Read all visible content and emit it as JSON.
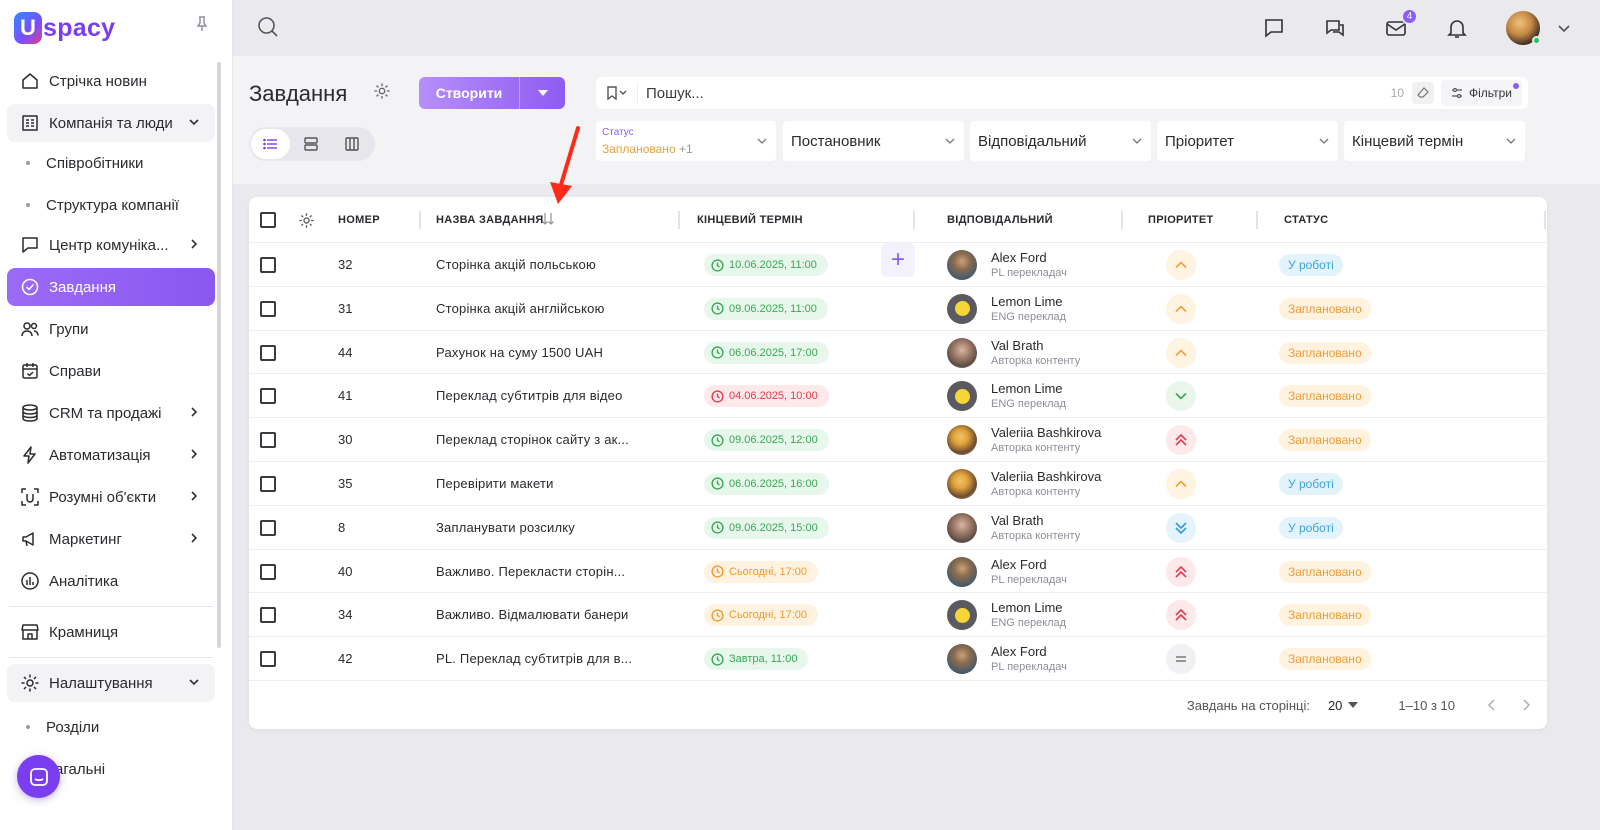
{
  "app": {
    "logo_letter": "U",
    "logo_text": "spacy"
  },
  "sidebar": {
    "items": [
      {
        "label": "Стрічка новин",
        "icon": "home-icon"
      },
      {
        "label": "Компанія та люди",
        "icon": "building-icon",
        "expanded": true
      },
      {
        "label": "Співробітники",
        "sub": true
      },
      {
        "label": "Структура компанії",
        "sub": true
      },
      {
        "label": "Центр комуніка...",
        "icon": "chat-icon"
      },
      {
        "label": "Завдання",
        "icon": "check-circle-icon",
        "active": true
      },
      {
        "label": "Групи",
        "icon": "users-icon"
      },
      {
        "label": "Справи",
        "icon": "calendar-icon"
      },
      {
        "label": "CRM та продажі",
        "icon": "database-icon"
      },
      {
        "label": "Автоматизація",
        "icon": "bolt-icon"
      },
      {
        "label": "Розумні об'єкти",
        "icon": "scan-icon"
      },
      {
        "label": "Маркетинг",
        "icon": "megaphone-icon"
      },
      {
        "label": "Аналітика",
        "icon": "chart-icon"
      },
      {
        "label": "Крамниця",
        "icon": "store-icon"
      },
      {
        "label": "Налаштування",
        "icon": "gear-icon",
        "expanded": true
      },
      {
        "label": "Розділи",
        "sub": true
      },
      {
        "label": "Загальні",
        "sub": true
      }
    ]
  },
  "topbar": {
    "mail_badge": "4"
  },
  "header": {
    "title": "Завдання",
    "create_label": "Створити",
    "search_placeholder": "Пошук...",
    "search_count": "10",
    "filters_label": "Фільтри",
    "filters": {
      "status_label": "Статус",
      "status_value": "Заплановано",
      "status_more": "+1",
      "author": "Постановник",
      "assignee": "Відповідальний",
      "priority": "Пріоритет",
      "deadline": "Кінцевий термін"
    }
  },
  "table": {
    "columns": {
      "number": "НОМЕР",
      "name": "НАЗВА ЗАВДАННЯ",
      "deadline": "КІНЦЕВИЙ ТЕРМІН",
      "assignee": "ВІДПОВІДАЛЬНИЙ",
      "priority": "ПРІОРИТЕТ",
      "status": "СТАТУС"
    },
    "rows": [
      {
        "num": "32",
        "name": "Сторінка акцій польською",
        "deadline": "10.06.2025, 11:00",
        "dl": "ok",
        "person": "Alex Ford",
        "role": "PL перекладач",
        "av": "alex",
        "priority": "medium",
        "status": "У роботі",
        "st": "work"
      },
      {
        "num": "31",
        "name": "Сторінка акцій англійською",
        "deadline": "09.06.2025, 11:00",
        "dl": "ok",
        "person": "Lemon Lime",
        "role": "ENG переклад",
        "av": "lemon",
        "priority": "medium",
        "status": "Заплановано",
        "st": "plan"
      },
      {
        "num": "44",
        "name": "Рахунок на суму 1500 UAH",
        "deadline": "06.06.2025, 17:00",
        "dl": "ok",
        "person": "Val Brath",
        "role": "Авторка контенту",
        "av": "val",
        "priority": "medium",
        "status": "Заплановано",
        "st": "plan"
      },
      {
        "num": "41",
        "name": "Переклад субтитрів для відео",
        "deadline": "04.06.2025, 10:00",
        "dl": "late",
        "person": "Lemon Lime",
        "role": "ENG переклад",
        "av": "lemon",
        "priority": "low",
        "status": "Заплановано",
        "st": "plan"
      },
      {
        "num": "30",
        "name": "Переклад сторінок сайту з ак...",
        "deadline": "09.06.2025, 12:00",
        "dl": "ok",
        "person": "Valeriia Bashkirova",
        "role": "Авторка контенту",
        "av": "valeriia",
        "priority": "high",
        "status": "Заплановано",
        "st": "plan"
      },
      {
        "num": "35",
        "name": "Перевірити макети",
        "deadline": "06.06.2025, 16:00",
        "dl": "ok",
        "person": "Valeriia Bashkirova",
        "role": "Авторка контенту",
        "av": "valeriia",
        "priority": "medium",
        "status": "У роботі",
        "st": "work"
      },
      {
        "num": "8",
        "name": "Запланувати розсилку",
        "deadline": "09.06.2025, 15:00",
        "dl": "ok",
        "person": "Val Brath",
        "role": "Авторка контенту",
        "av": "val",
        "priority": "lowest",
        "status": "У роботі",
        "st": "work"
      },
      {
        "num": "40",
        "name": "Важливо. Перекласти сторін...",
        "deadline": "Сьогодні, 17:00",
        "dl": "today",
        "person": "Alex Ford",
        "role": "PL перекладач",
        "av": "alex",
        "priority": "high",
        "status": "Заплановано",
        "st": "plan"
      },
      {
        "num": "34",
        "name": "Важливо. Відмалювати банери",
        "deadline": "Сьогодні, 17:00",
        "dl": "today",
        "person": "Lemon Lime",
        "role": "ENG переклад",
        "av": "lemon",
        "priority": "high",
        "status": "Заплановано",
        "st": "plan"
      },
      {
        "num": "42",
        "name": "PL. Переклад субтитрів для в...",
        "deadline": "Завтра, 11:00",
        "dl": "ok",
        "person": "Alex Ford",
        "role": "PL перекладач",
        "av": "alex",
        "priority": "none",
        "status": "Заплановано",
        "st": "plan"
      }
    ],
    "footer": {
      "per_page_label": "Завдань на сторінці:",
      "per_page": "20",
      "range": "1–10 з 10"
    }
  },
  "colors": {
    "accent": "#8b5cf6",
    "annotation_arrow": "#ff2a1a"
  }
}
